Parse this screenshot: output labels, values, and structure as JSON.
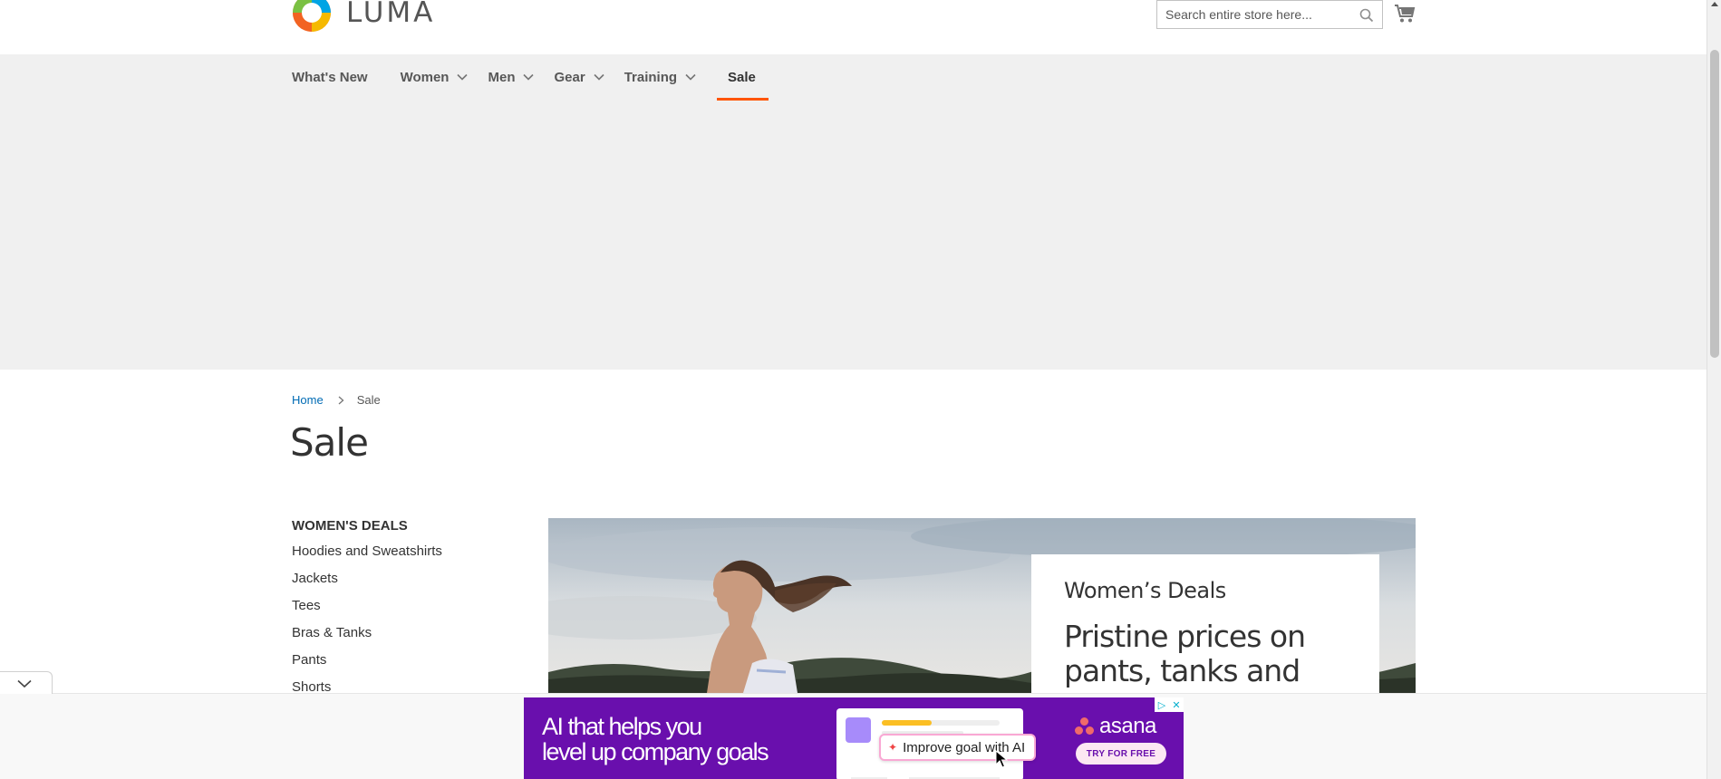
{
  "header": {
    "logo_text": "LUMA",
    "search_placeholder": "Search entire store here...",
    "search_icon": "search-icon",
    "cart_icon": "cart-icon"
  },
  "nav": {
    "items": [
      {
        "label": "What's New",
        "has_dropdown": false
      },
      {
        "label": "Women",
        "has_dropdown": true
      },
      {
        "label": "Men",
        "has_dropdown": true
      },
      {
        "label": "Gear",
        "has_dropdown": true
      },
      {
        "label": "Training",
        "has_dropdown": true
      },
      {
        "label": "Sale",
        "has_dropdown": false,
        "active": true
      }
    ],
    "accent_color": "#ff5501"
  },
  "breadcrumb": {
    "home": "Home",
    "current": "Sale"
  },
  "page": {
    "title": "Sale"
  },
  "sidebar": {
    "heading": "WOMEN'S DEALS",
    "links": [
      "Hoodies and Sweatshirts",
      "Jackets",
      "Tees",
      "Bras & Tanks",
      "Pants",
      "Shorts"
    ]
  },
  "hero": {
    "eyebrow": "Women’s Deals",
    "headline": "Pristine prices on pants, tanks and"
  },
  "ad": {
    "headline_line1": "AI that helps you",
    "headline_line2": "level up company goals",
    "pill": "Improve goal with AI",
    "brand": "asana",
    "cta": "TRY FOR FREE",
    "bg_color": "#690fad"
  }
}
